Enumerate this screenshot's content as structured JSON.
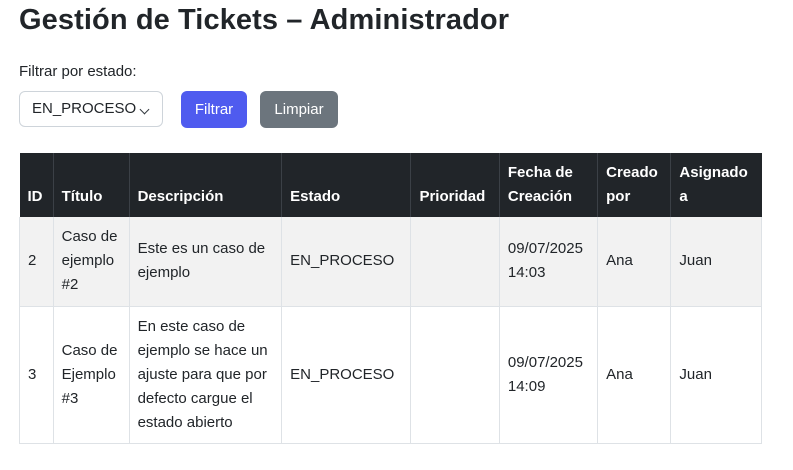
{
  "page": {
    "title": "Gestión de Tickets – Administrador"
  },
  "filter": {
    "label": "Filtrar por estado:",
    "selected_state": "EN_PROCESO",
    "filter_button": "Filtrar",
    "clear_button": "Limpiar"
  },
  "colors": {
    "primary_button": "#4f5bef",
    "secondary_button": "#6c757d",
    "table_header": "#212529"
  },
  "table": {
    "headers": {
      "id": "ID",
      "title": "Título",
      "description": "Descripción",
      "state": "Estado",
      "priority": "Prioridad",
      "created_date": "Fecha de Creación",
      "created_by": "Creado por",
      "assigned_to": "Asignado a"
    },
    "rows": [
      {
        "id": "2",
        "title": "Caso de ejemplo #2",
        "description": "Este es un caso de ejemplo",
        "state": "EN_PROCESO",
        "priority": "",
        "created_date": "09/07/2025 14:03",
        "created_by": "Ana",
        "assigned_to": "Juan"
      },
      {
        "id": "3",
        "title": "Caso de Ejemplo #3",
        "description": "En este caso de ejemplo se hace un ajuste para que por defecto cargue el estado abierto",
        "state": "EN_PROCESO",
        "priority": "",
        "created_date": "09/07/2025 14:09",
        "created_by": "Ana",
        "assigned_to": "Juan"
      }
    ]
  }
}
